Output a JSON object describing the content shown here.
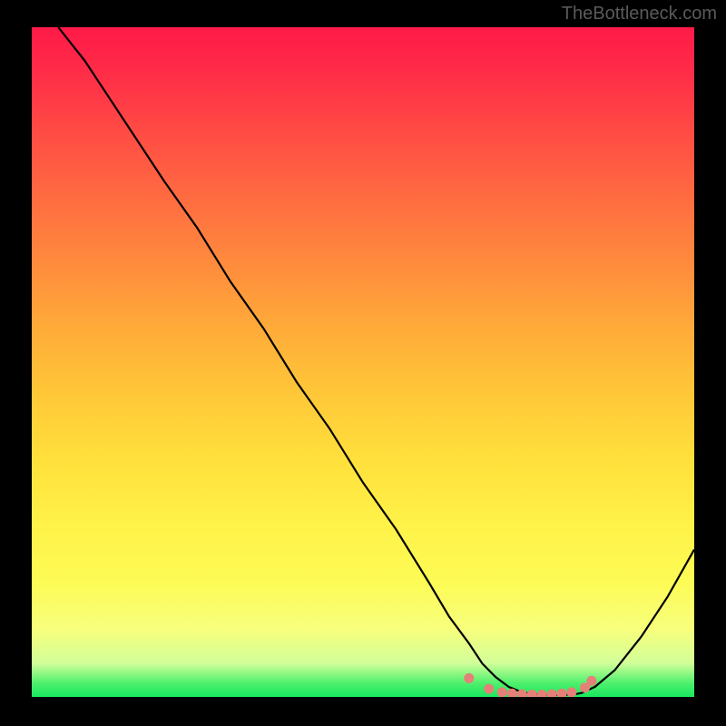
{
  "watermark": "TheBottleneck.com",
  "chart_data": {
    "type": "line",
    "title": "",
    "xlabel": "",
    "ylabel": "",
    "xlim": [
      0,
      100
    ],
    "ylim": [
      0,
      100
    ],
    "grid": false,
    "legend": false,
    "series": [
      {
        "name": "bottleneck-curve",
        "x": [
          4,
          8,
          12,
          16,
          20,
          25,
          30,
          35,
          40,
          45,
          50,
          55,
          60,
          63,
          66,
          68,
          70,
          72,
          74,
          76,
          78,
          80,
          82,
          83,
          85,
          88,
          92,
          96,
          100
        ],
        "y": [
          100,
          95,
          89,
          83,
          77,
          70,
          62,
          55,
          47,
          40,
          32,
          25,
          17,
          12,
          8,
          5,
          3,
          1.5,
          0.7,
          0.4,
          0.3,
          0.3,
          0.4,
          0.6,
          1.5,
          4,
          9,
          15,
          22
        ]
      }
    ],
    "markers": {
      "name": "minimum-region-dots",
      "color": "#e58078",
      "points": [
        {
          "x": 66,
          "y": 2.8
        },
        {
          "x": 69,
          "y": 1.2
        },
        {
          "x": 71,
          "y": 0.7
        },
        {
          "x": 72.5,
          "y": 0.5
        },
        {
          "x": 74,
          "y": 0.4
        },
        {
          "x": 75.5,
          "y": 0.35
        },
        {
          "x": 77,
          "y": 0.35
        },
        {
          "x": 78.5,
          "y": 0.4
        },
        {
          "x": 80,
          "y": 0.5
        },
        {
          "x": 81.5,
          "y": 0.7
        },
        {
          "x": 83.5,
          "y": 1.4
        },
        {
          "x": 84.5,
          "y": 2.4
        }
      ]
    },
    "gradient_stops": [
      {
        "pos": 0,
        "color": "#ff1a47"
      },
      {
        "pos": 15,
        "color": "#ff4944"
      },
      {
        "pos": 35,
        "color": "#ff8a3d"
      },
      {
        "pos": 55,
        "color": "#ffc838"
      },
      {
        "pos": 75,
        "color": "#fff349"
      },
      {
        "pos": 90,
        "color": "#f7ff7d"
      },
      {
        "pos": 98,
        "color": "#4cf06c"
      },
      {
        "pos": 100,
        "color": "#18e85f"
      }
    ]
  }
}
